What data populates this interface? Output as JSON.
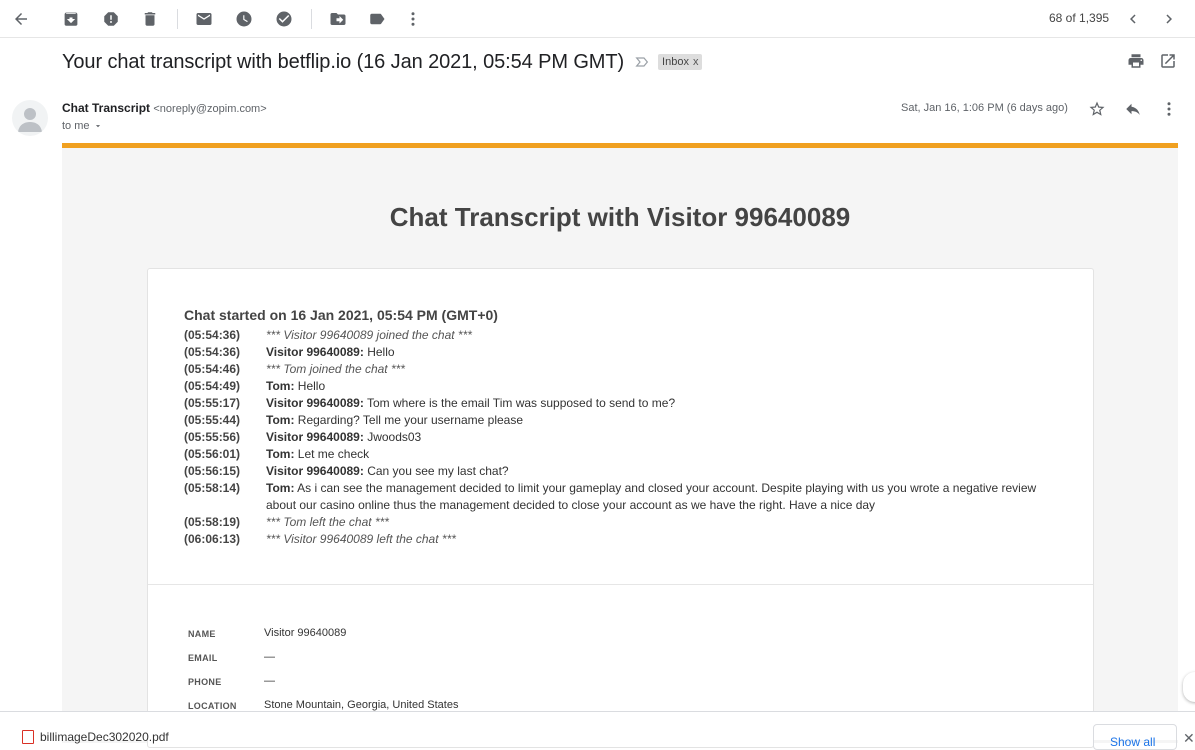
{
  "toolbar": {
    "pager": "68 of 1,395"
  },
  "message": {
    "subject": "Your chat transcript with betflip.io (16 Jan 2021, 05:54 PM GMT)",
    "label": "Inbox",
    "label_close": "x",
    "sender_name": "Chat Transcript",
    "sender_email": "<noreply@zopim.com>",
    "to": "to me",
    "date": "Sat, Jan 16, 1:06 PM (6 days ago)"
  },
  "transcript": {
    "title": "Chat Transcript with Visitor 99640089",
    "started": "Chat started on 16 Jan 2021, 05:54 PM (GMT+0)",
    "lines": [
      {
        "time": "(05:54:36)",
        "who": "",
        "text": "*** Visitor 99640089 joined the chat ***",
        "system": true
      },
      {
        "time": "(05:54:36)",
        "who": "Visitor 99640089:",
        "text": " Hello",
        "system": false
      },
      {
        "time": "(05:54:46)",
        "who": "",
        "text": "*** Tom joined the chat ***",
        "system": true
      },
      {
        "time": "(05:54:49)",
        "who": "Tom:",
        "text": " Hello",
        "system": false
      },
      {
        "time": "(05:55:17)",
        "who": "Visitor 99640089:",
        "text": " Tom where is the email Tim was supposed to send to me?",
        "system": false
      },
      {
        "time": "(05:55:44)",
        "who": "Tom:",
        "text": " Regarding? Tell me your username please",
        "system": false
      },
      {
        "time": "(05:55:56)",
        "who": "Visitor 99640089:",
        "text": " Jwoods03",
        "system": false
      },
      {
        "time": "(05:56:01)",
        "who": "Tom:",
        "text": " Let me check",
        "system": false
      },
      {
        "time": "(05:56:15)",
        "who": "Visitor 99640089:",
        "text": " Can you see my last chat?",
        "system": false
      },
      {
        "time": "(05:58:14)",
        "who": "Tom:",
        "text": " As i can see the management decided to limit your gameplay and closed your account. Despite playing with us you wrote a negative review about our casino online thus the management decided to close your account as we have the right. Have a nice day",
        "system": false
      },
      {
        "time": "(05:58:19)",
        "who": "",
        "text": "*** Tom left the chat ***",
        "system": true
      },
      {
        "time": "(06:06:13)",
        "who": "",
        "text": "*** Visitor 99640089 left the chat ***",
        "system": true
      }
    ],
    "info": [
      {
        "key": "NAME",
        "value": "Visitor 99640089"
      },
      {
        "key": "EMAIL",
        "value": "—"
      },
      {
        "key": "PHONE",
        "value": "—"
      },
      {
        "key": "LOCATION",
        "value": "Stone Mountain, Georgia, United States"
      }
    ]
  },
  "downloads": {
    "file": "billimageDec302020.pdf",
    "show_all": "Show all",
    "close": "✕"
  }
}
